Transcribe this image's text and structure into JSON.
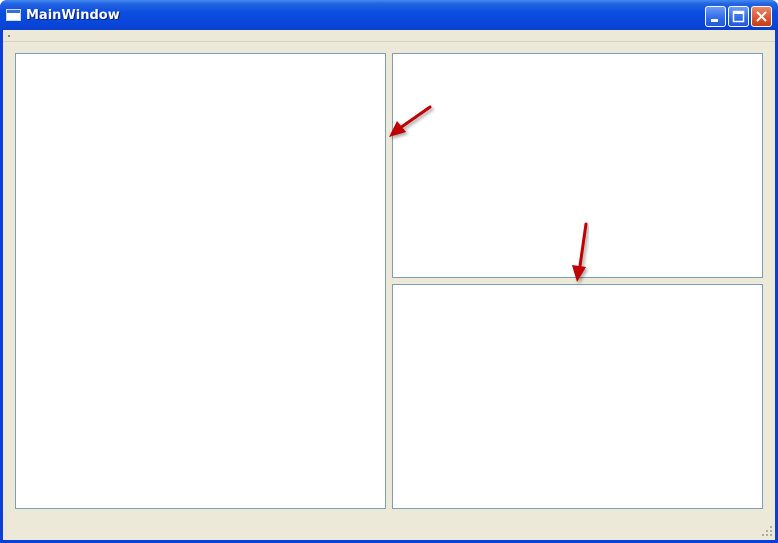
{
  "window": {
    "title": "MainWindow"
  },
  "icons": {
    "app": "window-icon",
    "minimize": "minimize-icon",
    "maximize": "maximize-icon",
    "close": "close-icon",
    "grip": "resize-grip-icon",
    "annotation": "red-arrow-icon"
  },
  "colors": {
    "titlebar": "#0a4fe0",
    "client_background": "#ece9d8",
    "pane_border": "#7f9db9",
    "close_button": "#d9542c",
    "annotation_arrow": "#c00000"
  }
}
